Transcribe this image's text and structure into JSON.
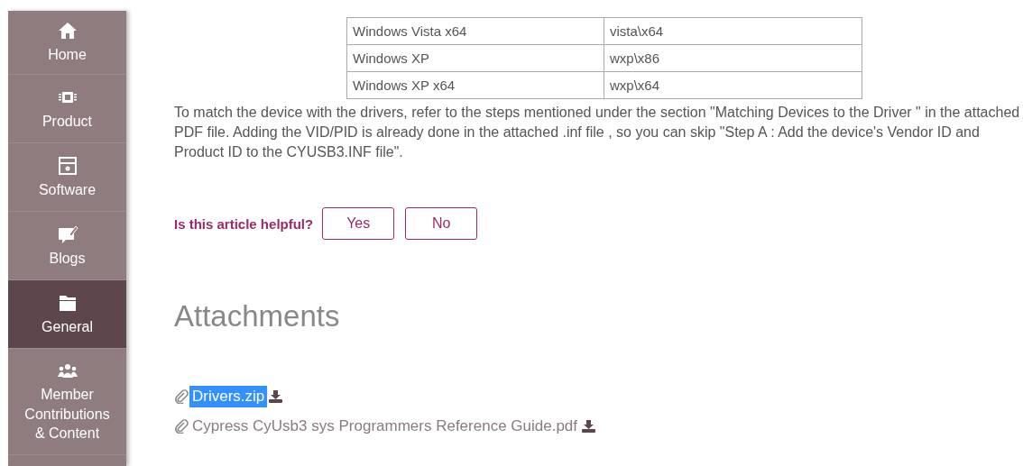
{
  "sidebar": {
    "items": [
      {
        "label": "Home",
        "selected": false
      },
      {
        "label": "Product",
        "selected": false
      },
      {
        "label": "Software",
        "selected": false
      },
      {
        "label": "Blogs",
        "selected": false
      },
      {
        "label": "General",
        "selected": true
      },
      {
        "label": "Member Contributions & Content",
        "selected": false
      }
    ]
  },
  "table": {
    "rows": [
      {
        "os": "Windows Vista x64",
        "folder": "vista\\x64"
      },
      {
        "os": "Windows XP",
        "folder": "wxp\\x86"
      },
      {
        "os": "Windows XP x64",
        "folder": "wxp\\x64"
      }
    ]
  },
  "paragraph": "To match the device with the drivers, refer to the steps mentioned under the section \"Matching Devices to the Driver \" in the attached PDF file. Adding the VID/PID is already done in the attached .inf file , so you can skip \"Step A : Add the device's Vendor ID and Product ID to the CYUSB3.INF file\".",
  "feedback": {
    "question": "Is this article helpful?",
    "buttons": [
      "Yes",
      "No"
    ]
  },
  "attachments": {
    "heading": "Attachments",
    "files": [
      {
        "name": "Drivers.zip",
        "highlighted": true
      },
      {
        "name": "Cypress CyUsb3 sys Programmers Reference Guide.pdf",
        "highlighted": false
      }
    ]
  }
}
